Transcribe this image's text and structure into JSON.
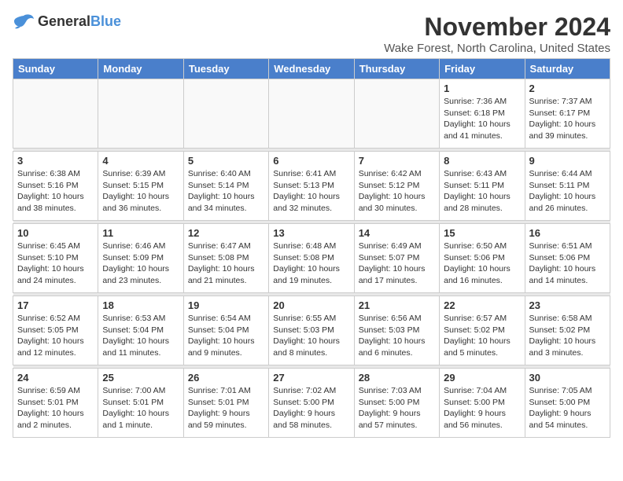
{
  "header": {
    "logo_general": "General",
    "logo_blue": "Blue",
    "month_title": "November 2024",
    "location": "Wake Forest, North Carolina, United States"
  },
  "calendar": {
    "days_of_week": [
      "Sunday",
      "Monday",
      "Tuesday",
      "Wednesday",
      "Thursday",
      "Friday",
      "Saturday"
    ],
    "weeks": [
      [
        {
          "day": "",
          "info": ""
        },
        {
          "day": "",
          "info": ""
        },
        {
          "day": "",
          "info": ""
        },
        {
          "day": "",
          "info": ""
        },
        {
          "day": "",
          "info": ""
        },
        {
          "day": "1",
          "info": "Sunrise: 7:36 AM\nSunset: 6:18 PM\nDaylight: 10 hours\nand 41 minutes."
        },
        {
          "day": "2",
          "info": "Sunrise: 7:37 AM\nSunset: 6:17 PM\nDaylight: 10 hours\nand 39 minutes."
        }
      ],
      [
        {
          "day": "3",
          "info": "Sunrise: 6:38 AM\nSunset: 5:16 PM\nDaylight: 10 hours\nand 38 minutes."
        },
        {
          "day": "4",
          "info": "Sunrise: 6:39 AM\nSunset: 5:15 PM\nDaylight: 10 hours\nand 36 minutes."
        },
        {
          "day": "5",
          "info": "Sunrise: 6:40 AM\nSunset: 5:14 PM\nDaylight: 10 hours\nand 34 minutes."
        },
        {
          "day": "6",
          "info": "Sunrise: 6:41 AM\nSunset: 5:13 PM\nDaylight: 10 hours\nand 32 minutes."
        },
        {
          "day": "7",
          "info": "Sunrise: 6:42 AM\nSunset: 5:12 PM\nDaylight: 10 hours\nand 30 minutes."
        },
        {
          "day": "8",
          "info": "Sunrise: 6:43 AM\nSunset: 5:11 PM\nDaylight: 10 hours\nand 28 minutes."
        },
        {
          "day": "9",
          "info": "Sunrise: 6:44 AM\nSunset: 5:11 PM\nDaylight: 10 hours\nand 26 minutes."
        }
      ],
      [
        {
          "day": "10",
          "info": "Sunrise: 6:45 AM\nSunset: 5:10 PM\nDaylight: 10 hours\nand 24 minutes."
        },
        {
          "day": "11",
          "info": "Sunrise: 6:46 AM\nSunset: 5:09 PM\nDaylight: 10 hours\nand 23 minutes."
        },
        {
          "day": "12",
          "info": "Sunrise: 6:47 AM\nSunset: 5:08 PM\nDaylight: 10 hours\nand 21 minutes."
        },
        {
          "day": "13",
          "info": "Sunrise: 6:48 AM\nSunset: 5:08 PM\nDaylight: 10 hours\nand 19 minutes."
        },
        {
          "day": "14",
          "info": "Sunrise: 6:49 AM\nSunset: 5:07 PM\nDaylight: 10 hours\nand 17 minutes."
        },
        {
          "day": "15",
          "info": "Sunrise: 6:50 AM\nSunset: 5:06 PM\nDaylight: 10 hours\nand 16 minutes."
        },
        {
          "day": "16",
          "info": "Sunrise: 6:51 AM\nSunset: 5:06 PM\nDaylight: 10 hours\nand 14 minutes."
        }
      ],
      [
        {
          "day": "17",
          "info": "Sunrise: 6:52 AM\nSunset: 5:05 PM\nDaylight: 10 hours\nand 12 minutes."
        },
        {
          "day": "18",
          "info": "Sunrise: 6:53 AM\nSunset: 5:04 PM\nDaylight: 10 hours\nand 11 minutes."
        },
        {
          "day": "19",
          "info": "Sunrise: 6:54 AM\nSunset: 5:04 PM\nDaylight: 10 hours\nand 9 minutes."
        },
        {
          "day": "20",
          "info": "Sunrise: 6:55 AM\nSunset: 5:03 PM\nDaylight: 10 hours\nand 8 minutes."
        },
        {
          "day": "21",
          "info": "Sunrise: 6:56 AM\nSunset: 5:03 PM\nDaylight: 10 hours\nand 6 minutes."
        },
        {
          "day": "22",
          "info": "Sunrise: 6:57 AM\nSunset: 5:02 PM\nDaylight: 10 hours\nand 5 minutes."
        },
        {
          "day": "23",
          "info": "Sunrise: 6:58 AM\nSunset: 5:02 PM\nDaylight: 10 hours\nand 3 minutes."
        }
      ],
      [
        {
          "day": "24",
          "info": "Sunrise: 6:59 AM\nSunset: 5:01 PM\nDaylight: 10 hours\nand 2 minutes."
        },
        {
          "day": "25",
          "info": "Sunrise: 7:00 AM\nSunset: 5:01 PM\nDaylight: 10 hours\nand 1 minute."
        },
        {
          "day": "26",
          "info": "Sunrise: 7:01 AM\nSunset: 5:01 PM\nDaylight: 9 hours\nand 59 minutes."
        },
        {
          "day": "27",
          "info": "Sunrise: 7:02 AM\nSunset: 5:00 PM\nDaylight: 9 hours\nand 58 minutes."
        },
        {
          "day": "28",
          "info": "Sunrise: 7:03 AM\nSunset: 5:00 PM\nDaylight: 9 hours\nand 57 minutes."
        },
        {
          "day": "29",
          "info": "Sunrise: 7:04 AM\nSunset: 5:00 PM\nDaylight: 9 hours\nand 56 minutes."
        },
        {
          "day": "30",
          "info": "Sunrise: 7:05 AM\nSunset: 5:00 PM\nDaylight: 9 hours\nand 54 minutes."
        }
      ]
    ]
  }
}
